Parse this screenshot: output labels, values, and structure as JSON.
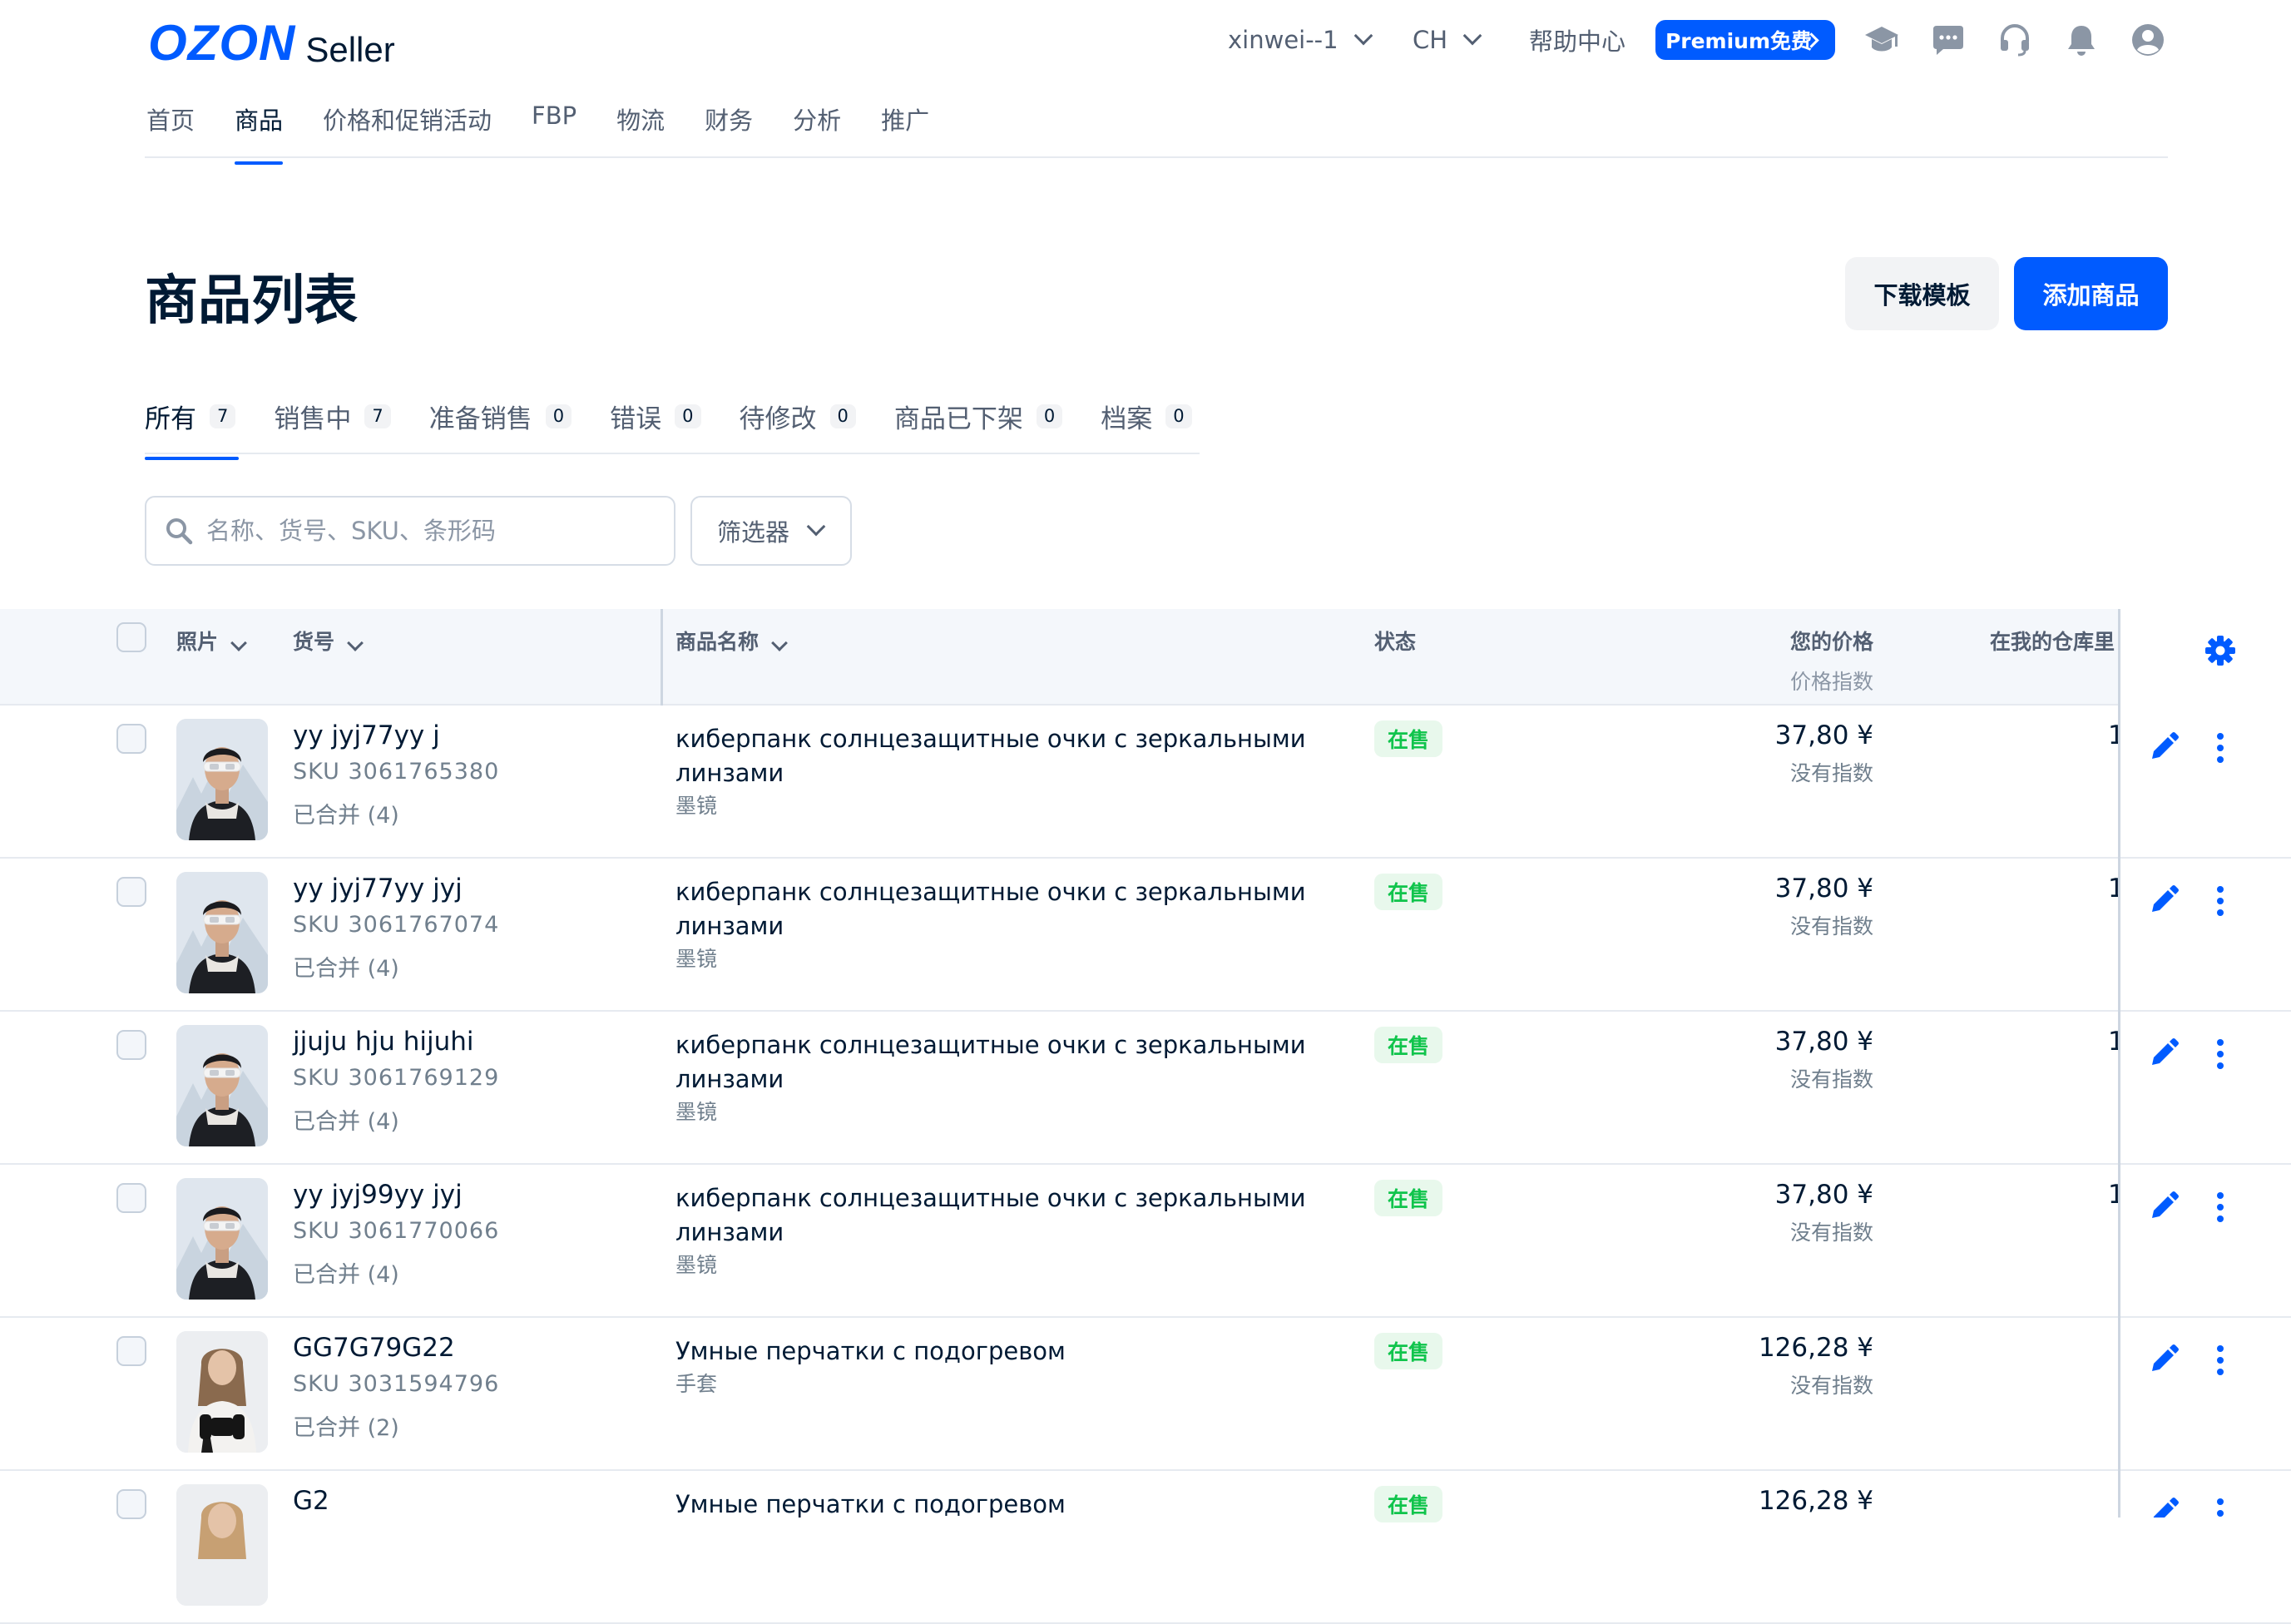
{
  "header": {
    "logo": "OZON",
    "logo_suffix": "Seller",
    "account": "xinwei--1",
    "language": "CH",
    "help": "帮助中心",
    "premium": "Premium免费"
  },
  "nav": [
    "首页",
    "商品",
    "价格和促销活动",
    "FBP",
    "物流",
    "财务",
    "分析",
    "推广"
  ],
  "page": {
    "title": "商品列表",
    "download_template": "下载模板",
    "add_product": "添加商品"
  },
  "tabs": [
    {
      "label": "所有",
      "count": "7"
    },
    {
      "label": "销售中",
      "count": "7"
    },
    {
      "label": "准备销售",
      "count": "0"
    },
    {
      "label": "错误",
      "count": "0"
    },
    {
      "label": "待修改",
      "count": "0"
    },
    {
      "label": "商品已下架",
      "count": "0"
    },
    {
      "label": "档案",
      "count": "0"
    }
  ],
  "search": {
    "placeholder": "名称、货号、SKU、条形码",
    "value": ""
  },
  "filter": {
    "label": "筛选器"
  },
  "table": {
    "columns": {
      "photo": "照片",
      "article": "货号",
      "name": "商品名称",
      "status": "状态",
      "price": "您的价格",
      "price_index": "价格指数",
      "stock": "在我的仓库里"
    },
    "rows": [
      {
        "article": "yy jyj77yy j",
        "sku": "SKU 3061765380",
        "merged": "已合并 (4)",
        "name": "киберпанк солнцезащитные очки с зеркальными линзами",
        "category": "墨镜",
        "status": "在售",
        "price": "37,80 ¥",
        "price_index": "没有指数",
        "stock": "1"
      },
      {
        "article": "yy jyj77yy jyj",
        "sku": "SKU 3061767074",
        "merged": "已合并 (4)",
        "name": "киберпанк солнцезащитные очки с зеркальными линзами",
        "category": "墨镜",
        "status": "在售",
        "price": "37,80 ¥",
        "price_index": "没有指数",
        "stock": "1"
      },
      {
        "article": "jjuju hju hijuhi",
        "sku": "SKU 3061769129",
        "merged": "已合并 (4)",
        "name": "киберпанк солнцезащитные очки с зеркальными линзами",
        "category": "墨镜",
        "status": "在售",
        "price": "37,80 ¥",
        "price_index": "没有指数",
        "stock": "1"
      },
      {
        "article": "yy jyj99yy jyj",
        "sku": "SKU 3061770066",
        "merged": "已合并 (4)",
        "name": "киберпанк солнцезащитные очки с зеркальными линзами",
        "category": "墨镜",
        "status": "在售",
        "price": "37,80 ¥",
        "price_index": "没有指数",
        "stock": "1"
      },
      {
        "article": "GG7G79G22",
        "sku": "SKU 3031594796",
        "merged": "已合并 (2)",
        "name": "Умные перчатки с подогревом",
        "category": "手套",
        "status": "在售",
        "price": "126,28 ¥",
        "price_index": "没有指数",
        "stock": ""
      },
      {
        "article": "G2",
        "sku": "",
        "merged": "",
        "name": "Умные перчатки с подогревом",
        "category": "",
        "status": "在售",
        "price": "126,28 ¥",
        "price_index": "",
        "stock": ""
      }
    ]
  },
  "colors": {
    "accent": "#005bff",
    "status_green": "#10c44c",
    "status_bg": "#e8f8ec",
    "text": "#001a34",
    "muted": "#707f8d"
  }
}
